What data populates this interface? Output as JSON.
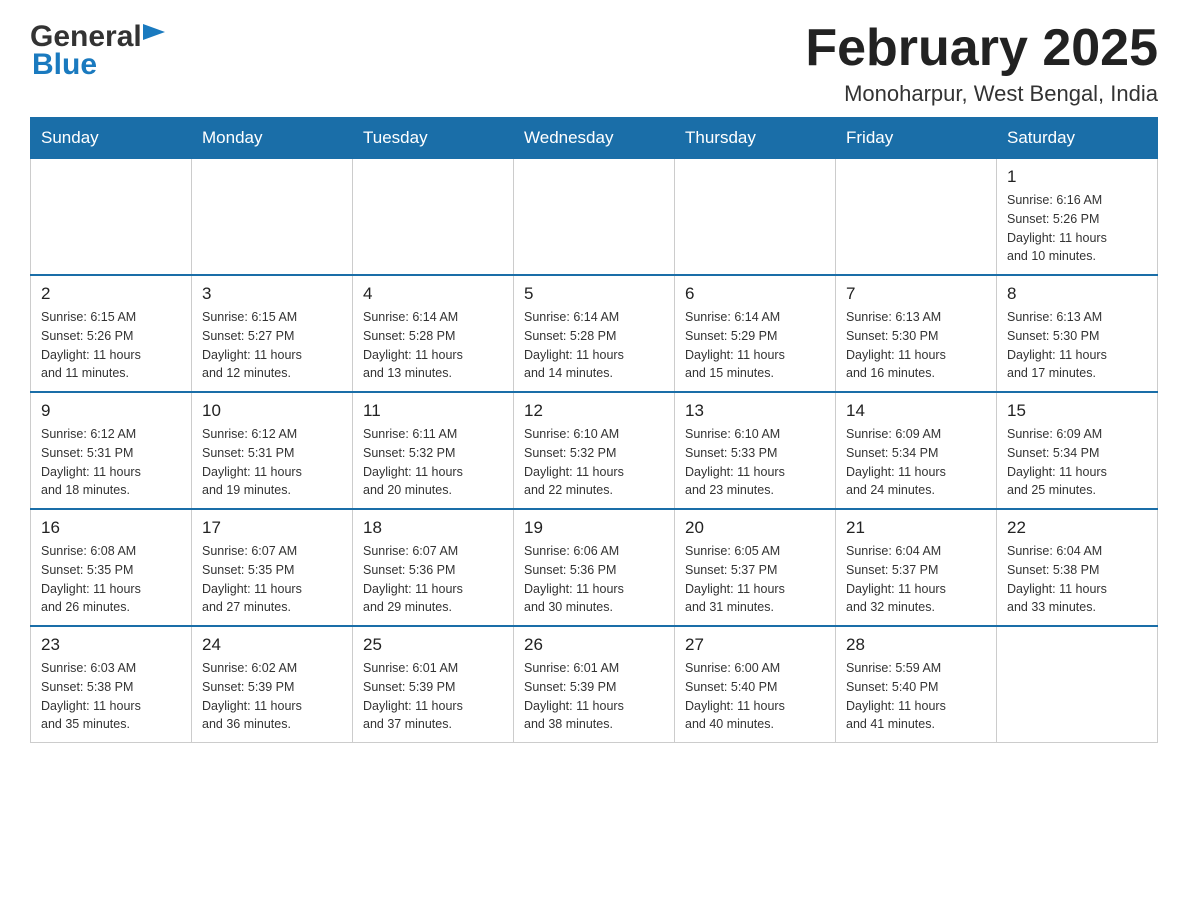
{
  "header": {
    "logo_general": "General",
    "logo_blue": "Blue",
    "month_title": "February 2025",
    "location": "Monoharpur, West Bengal, India"
  },
  "days_of_week": [
    "Sunday",
    "Monday",
    "Tuesday",
    "Wednesday",
    "Thursday",
    "Friday",
    "Saturday"
  ],
  "weeks": [
    [
      {
        "day": "",
        "info": ""
      },
      {
        "day": "",
        "info": ""
      },
      {
        "day": "",
        "info": ""
      },
      {
        "day": "",
        "info": ""
      },
      {
        "day": "",
        "info": ""
      },
      {
        "day": "",
        "info": ""
      },
      {
        "day": "1",
        "info": "Sunrise: 6:16 AM\nSunset: 5:26 PM\nDaylight: 11 hours\nand 10 minutes."
      }
    ],
    [
      {
        "day": "2",
        "info": "Sunrise: 6:15 AM\nSunset: 5:26 PM\nDaylight: 11 hours\nand 11 minutes."
      },
      {
        "day": "3",
        "info": "Sunrise: 6:15 AM\nSunset: 5:27 PM\nDaylight: 11 hours\nand 12 minutes."
      },
      {
        "day": "4",
        "info": "Sunrise: 6:14 AM\nSunset: 5:28 PM\nDaylight: 11 hours\nand 13 minutes."
      },
      {
        "day": "5",
        "info": "Sunrise: 6:14 AM\nSunset: 5:28 PM\nDaylight: 11 hours\nand 14 minutes."
      },
      {
        "day": "6",
        "info": "Sunrise: 6:14 AM\nSunset: 5:29 PM\nDaylight: 11 hours\nand 15 minutes."
      },
      {
        "day": "7",
        "info": "Sunrise: 6:13 AM\nSunset: 5:30 PM\nDaylight: 11 hours\nand 16 minutes."
      },
      {
        "day": "8",
        "info": "Sunrise: 6:13 AM\nSunset: 5:30 PM\nDaylight: 11 hours\nand 17 minutes."
      }
    ],
    [
      {
        "day": "9",
        "info": "Sunrise: 6:12 AM\nSunset: 5:31 PM\nDaylight: 11 hours\nand 18 minutes."
      },
      {
        "day": "10",
        "info": "Sunrise: 6:12 AM\nSunset: 5:31 PM\nDaylight: 11 hours\nand 19 minutes."
      },
      {
        "day": "11",
        "info": "Sunrise: 6:11 AM\nSunset: 5:32 PM\nDaylight: 11 hours\nand 20 minutes."
      },
      {
        "day": "12",
        "info": "Sunrise: 6:10 AM\nSunset: 5:32 PM\nDaylight: 11 hours\nand 22 minutes."
      },
      {
        "day": "13",
        "info": "Sunrise: 6:10 AM\nSunset: 5:33 PM\nDaylight: 11 hours\nand 23 minutes."
      },
      {
        "day": "14",
        "info": "Sunrise: 6:09 AM\nSunset: 5:34 PM\nDaylight: 11 hours\nand 24 minutes."
      },
      {
        "day": "15",
        "info": "Sunrise: 6:09 AM\nSunset: 5:34 PM\nDaylight: 11 hours\nand 25 minutes."
      }
    ],
    [
      {
        "day": "16",
        "info": "Sunrise: 6:08 AM\nSunset: 5:35 PM\nDaylight: 11 hours\nand 26 minutes."
      },
      {
        "day": "17",
        "info": "Sunrise: 6:07 AM\nSunset: 5:35 PM\nDaylight: 11 hours\nand 27 minutes."
      },
      {
        "day": "18",
        "info": "Sunrise: 6:07 AM\nSunset: 5:36 PM\nDaylight: 11 hours\nand 29 minutes."
      },
      {
        "day": "19",
        "info": "Sunrise: 6:06 AM\nSunset: 5:36 PM\nDaylight: 11 hours\nand 30 minutes."
      },
      {
        "day": "20",
        "info": "Sunrise: 6:05 AM\nSunset: 5:37 PM\nDaylight: 11 hours\nand 31 minutes."
      },
      {
        "day": "21",
        "info": "Sunrise: 6:04 AM\nSunset: 5:37 PM\nDaylight: 11 hours\nand 32 minutes."
      },
      {
        "day": "22",
        "info": "Sunrise: 6:04 AM\nSunset: 5:38 PM\nDaylight: 11 hours\nand 33 minutes."
      }
    ],
    [
      {
        "day": "23",
        "info": "Sunrise: 6:03 AM\nSunset: 5:38 PM\nDaylight: 11 hours\nand 35 minutes."
      },
      {
        "day": "24",
        "info": "Sunrise: 6:02 AM\nSunset: 5:39 PM\nDaylight: 11 hours\nand 36 minutes."
      },
      {
        "day": "25",
        "info": "Sunrise: 6:01 AM\nSunset: 5:39 PM\nDaylight: 11 hours\nand 37 minutes."
      },
      {
        "day": "26",
        "info": "Sunrise: 6:01 AM\nSunset: 5:39 PM\nDaylight: 11 hours\nand 38 minutes."
      },
      {
        "day": "27",
        "info": "Sunrise: 6:00 AM\nSunset: 5:40 PM\nDaylight: 11 hours\nand 40 minutes."
      },
      {
        "day": "28",
        "info": "Sunrise: 5:59 AM\nSunset: 5:40 PM\nDaylight: 11 hours\nand 41 minutes."
      },
      {
        "day": "",
        "info": ""
      }
    ]
  ]
}
